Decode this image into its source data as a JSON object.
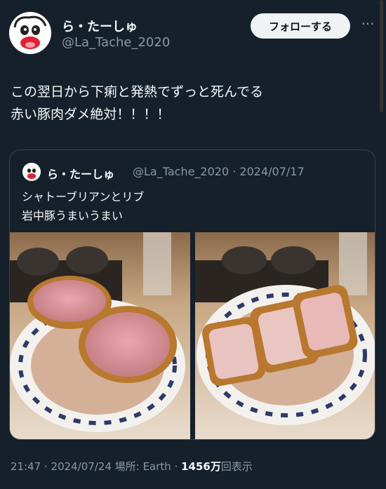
{
  "author": {
    "display_name": "ら・たーしゅ",
    "handle": "@La_Tache_2020"
  },
  "follow_label": "フォローする",
  "more_icon": "more-icon",
  "tweet": {
    "text": "この翌日から下痢と発熱でずっと死んでる\n赤い豚肉ダメ絶対！！！！"
  },
  "quoted": {
    "display_name": "ら・たーしゅ",
    "handle_date": "@La_Tache_2020 · 2024/07/17",
    "text": "シャトーブリアンとリブ\n岩中豚うまいうまい",
    "photos": [
      "fried pork cutlet on wire rack plate",
      "sliced pork cutlet on wire rack plate"
    ]
  },
  "footer": {
    "meta": "21:47 · 2024/07/24 場所: Earth · ",
    "views_count": "1456万",
    "views_label": "回表示"
  },
  "colors": {
    "background": "#15202b",
    "text": "#f7f9f9",
    "muted": "#8b98a5",
    "border": "#38444d"
  }
}
